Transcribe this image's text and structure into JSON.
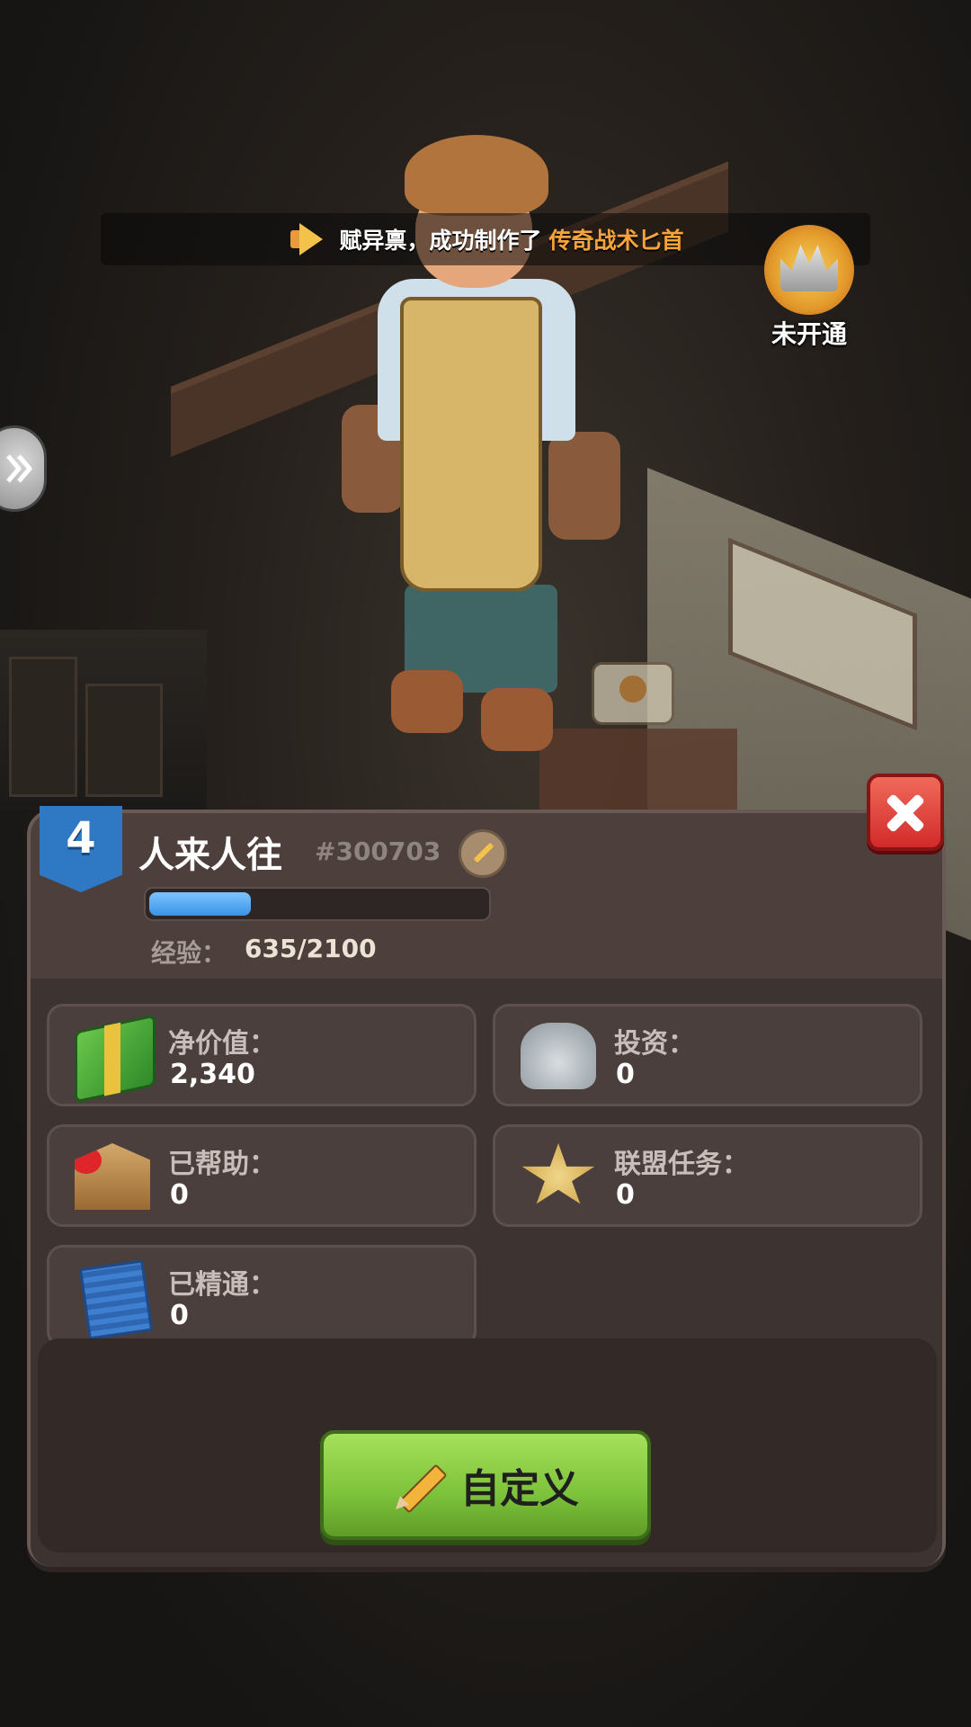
{
  "ticker": {
    "text_prefix": "赋异禀，成功制作了",
    "text_highlight": "传奇战术匕首"
  },
  "rank_badge": {
    "label": "未开通"
  },
  "profile": {
    "level": "4",
    "name": "人来人往",
    "id": "#300703",
    "xp_label": "经验：",
    "xp_value": "635/2100",
    "xp_progress": 0.302
  },
  "stats": [
    {
      "label": "净价值：",
      "value": "2,340",
      "icon": "money-stack-icon"
    },
    {
      "label": "投资：",
      "value": "0",
      "icon": "investment-buildings-icon"
    },
    {
      "label": "已帮助：",
      "value": "0",
      "icon": "charity-heart-icon"
    },
    {
      "label": "联盟任务：",
      "value": "0",
      "icon": "sheriff-badge-icon"
    },
    {
      "label": "已精通：",
      "value": "0",
      "icon": "blueprint-icon"
    }
  ],
  "buttons": {
    "customize_label": "自定义"
  },
  "colors": {
    "panel": "#4d403c",
    "accent_green": "#7cc23a",
    "close_red": "#d22a2a",
    "level_blue": "#2f79c4",
    "highlight_orange": "#f7a43a"
  }
}
